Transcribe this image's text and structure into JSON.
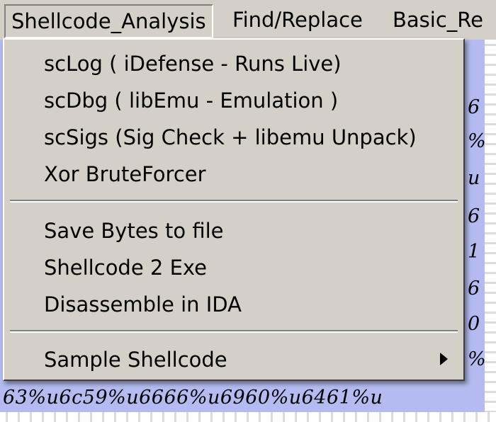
{
  "menubar": {
    "items": [
      {
        "label": "Shellcode_Analysis"
      },
      {
        "label": "Find/Replace"
      },
      {
        "label": "Basic_Re"
      }
    ]
  },
  "menu": {
    "group1": [
      {
        "label": "scLog ( iDefense - Runs Live)"
      },
      {
        "label": "scDbg ( libEmu - Emulation )"
      },
      {
        "label": "scSigs  (Sig Check + libemu Unpack)"
      },
      {
        "label": "Xor BruteForcer"
      }
    ],
    "group2": [
      {
        "label": "Save Bytes to file"
      },
      {
        "label": "Shellcode 2 Exe"
      },
      {
        "label": "Disassemble in IDA"
      }
    ],
    "group3": [
      {
        "label": "Sample Shellcode"
      }
    ]
  },
  "background": {
    "right_column": [
      "6",
      "%",
      "u",
      "6",
      "1",
      "6",
      "0",
      "%"
    ],
    "bottom_line": "63%u6c59%u6666%u6960%u6461%u"
  }
}
